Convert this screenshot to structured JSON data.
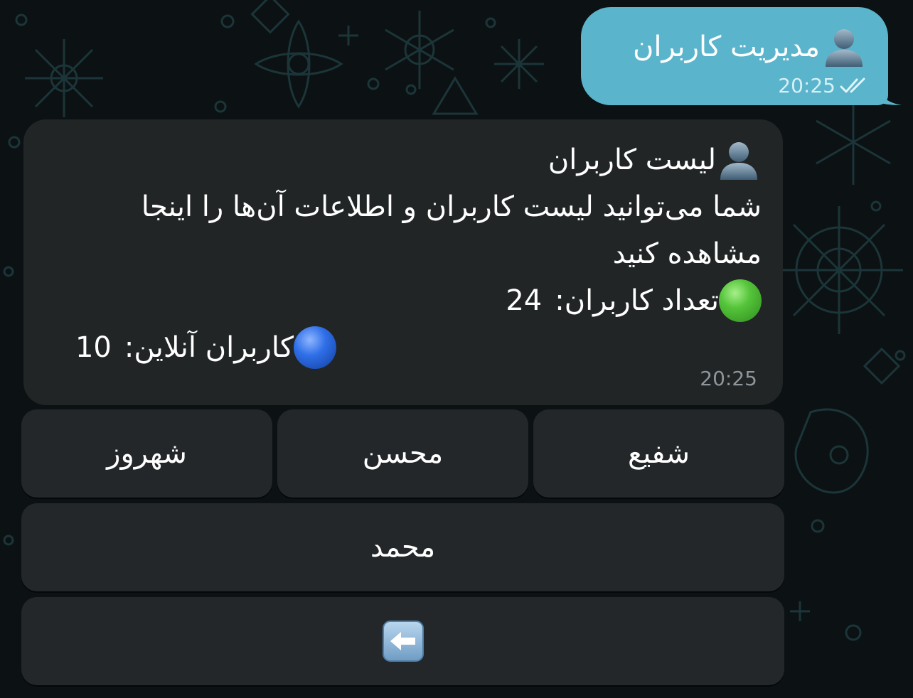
{
  "outgoing_message": {
    "text": "مدیریت کاربران",
    "icon": "person-icon",
    "time": "20:25",
    "status_icon": "double-check-icon"
  },
  "incoming_message": {
    "title": "لیست کاربران",
    "title_icon": "person-icon",
    "description_line1": "شما می‌توانید لیست کاربران و اطلاعات آن‌ها را اینجا",
    "description_line2": "مشاهده کنید",
    "users_count_label": "تعداد کاربران:",
    "users_count_value": "24",
    "users_count_icon": "green-circle-icon",
    "online_users_label": "کاربران آنلاین:",
    "online_users_value": "10",
    "online_users_icon": "blue-circle-icon",
    "time": "20:25"
  },
  "keyboard": {
    "row1": [
      "شفیع",
      "محسن",
      "شهروز"
    ],
    "row2": [
      "محمد"
    ],
    "back_button_icon": "left-arrow-icon"
  },
  "colors": {
    "background": "#0c1114",
    "outgoing_bubble": "#5ab4cb",
    "incoming_bubble": "#212526",
    "keyboard_button": "#232729",
    "timestamp_incoming": "#8f9699"
  }
}
